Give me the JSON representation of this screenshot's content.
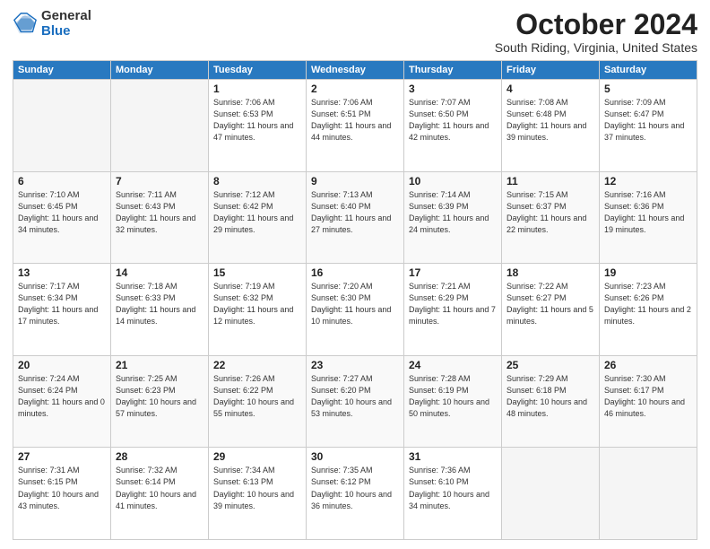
{
  "logo": {
    "general": "General",
    "blue": "Blue"
  },
  "header": {
    "month": "October 2024",
    "location": "South Riding, Virginia, United States"
  },
  "days_of_week": [
    "Sunday",
    "Monday",
    "Tuesday",
    "Wednesday",
    "Thursday",
    "Friday",
    "Saturday"
  ],
  "weeks": [
    [
      {
        "day": "",
        "info": ""
      },
      {
        "day": "",
        "info": ""
      },
      {
        "day": "1",
        "info": "Sunrise: 7:06 AM\nSunset: 6:53 PM\nDaylight: 11 hours and 47 minutes."
      },
      {
        "day": "2",
        "info": "Sunrise: 7:06 AM\nSunset: 6:51 PM\nDaylight: 11 hours and 44 minutes."
      },
      {
        "day": "3",
        "info": "Sunrise: 7:07 AM\nSunset: 6:50 PM\nDaylight: 11 hours and 42 minutes."
      },
      {
        "day": "4",
        "info": "Sunrise: 7:08 AM\nSunset: 6:48 PM\nDaylight: 11 hours and 39 minutes."
      },
      {
        "day": "5",
        "info": "Sunrise: 7:09 AM\nSunset: 6:47 PM\nDaylight: 11 hours and 37 minutes."
      }
    ],
    [
      {
        "day": "6",
        "info": "Sunrise: 7:10 AM\nSunset: 6:45 PM\nDaylight: 11 hours and 34 minutes."
      },
      {
        "day": "7",
        "info": "Sunrise: 7:11 AM\nSunset: 6:43 PM\nDaylight: 11 hours and 32 minutes."
      },
      {
        "day": "8",
        "info": "Sunrise: 7:12 AM\nSunset: 6:42 PM\nDaylight: 11 hours and 29 minutes."
      },
      {
        "day": "9",
        "info": "Sunrise: 7:13 AM\nSunset: 6:40 PM\nDaylight: 11 hours and 27 minutes."
      },
      {
        "day": "10",
        "info": "Sunrise: 7:14 AM\nSunset: 6:39 PM\nDaylight: 11 hours and 24 minutes."
      },
      {
        "day": "11",
        "info": "Sunrise: 7:15 AM\nSunset: 6:37 PM\nDaylight: 11 hours and 22 minutes."
      },
      {
        "day": "12",
        "info": "Sunrise: 7:16 AM\nSunset: 6:36 PM\nDaylight: 11 hours and 19 minutes."
      }
    ],
    [
      {
        "day": "13",
        "info": "Sunrise: 7:17 AM\nSunset: 6:34 PM\nDaylight: 11 hours and 17 minutes."
      },
      {
        "day": "14",
        "info": "Sunrise: 7:18 AM\nSunset: 6:33 PM\nDaylight: 11 hours and 14 minutes."
      },
      {
        "day": "15",
        "info": "Sunrise: 7:19 AM\nSunset: 6:32 PM\nDaylight: 11 hours and 12 minutes."
      },
      {
        "day": "16",
        "info": "Sunrise: 7:20 AM\nSunset: 6:30 PM\nDaylight: 11 hours and 10 minutes."
      },
      {
        "day": "17",
        "info": "Sunrise: 7:21 AM\nSunset: 6:29 PM\nDaylight: 11 hours and 7 minutes."
      },
      {
        "day": "18",
        "info": "Sunrise: 7:22 AM\nSunset: 6:27 PM\nDaylight: 11 hours and 5 minutes."
      },
      {
        "day": "19",
        "info": "Sunrise: 7:23 AM\nSunset: 6:26 PM\nDaylight: 11 hours and 2 minutes."
      }
    ],
    [
      {
        "day": "20",
        "info": "Sunrise: 7:24 AM\nSunset: 6:24 PM\nDaylight: 11 hours and 0 minutes."
      },
      {
        "day": "21",
        "info": "Sunrise: 7:25 AM\nSunset: 6:23 PM\nDaylight: 10 hours and 57 minutes."
      },
      {
        "day": "22",
        "info": "Sunrise: 7:26 AM\nSunset: 6:22 PM\nDaylight: 10 hours and 55 minutes."
      },
      {
        "day": "23",
        "info": "Sunrise: 7:27 AM\nSunset: 6:20 PM\nDaylight: 10 hours and 53 minutes."
      },
      {
        "day": "24",
        "info": "Sunrise: 7:28 AM\nSunset: 6:19 PM\nDaylight: 10 hours and 50 minutes."
      },
      {
        "day": "25",
        "info": "Sunrise: 7:29 AM\nSunset: 6:18 PM\nDaylight: 10 hours and 48 minutes."
      },
      {
        "day": "26",
        "info": "Sunrise: 7:30 AM\nSunset: 6:17 PM\nDaylight: 10 hours and 46 minutes."
      }
    ],
    [
      {
        "day": "27",
        "info": "Sunrise: 7:31 AM\nSunset: 6:15 PM\nDaylight: 10 hours and 43 minutes."
      },
      {
        "day": "28",
        "info": "Sunrise: 7:32 AM\nSunset: 6:14 PM\nDaylight: 10 hours and 41 minutes."
      },
      {
        "day": "29",
        "info": "Sunrise: 7:34 AM\nSunset: 6:13 PM\nDaylight: 10 hours and 39 minutes."
      },
      {
        "day": "30",
        "info": "Sunrise: 7:35 AM\nSunset: 6:12 PM\nDaylight: 10 hours and 36 minutes."
      },
      {
        "day": "31",
        "info": "Sunrise: 7:36 AM\nSunset: 6:10 PM\nDaylight: 10 hours and 34 minutes."
      },
      {
        "day": "",
        "info": ""
      },
      {
        "day": "",
        "info": ""
      }
    ]
  ]
}
